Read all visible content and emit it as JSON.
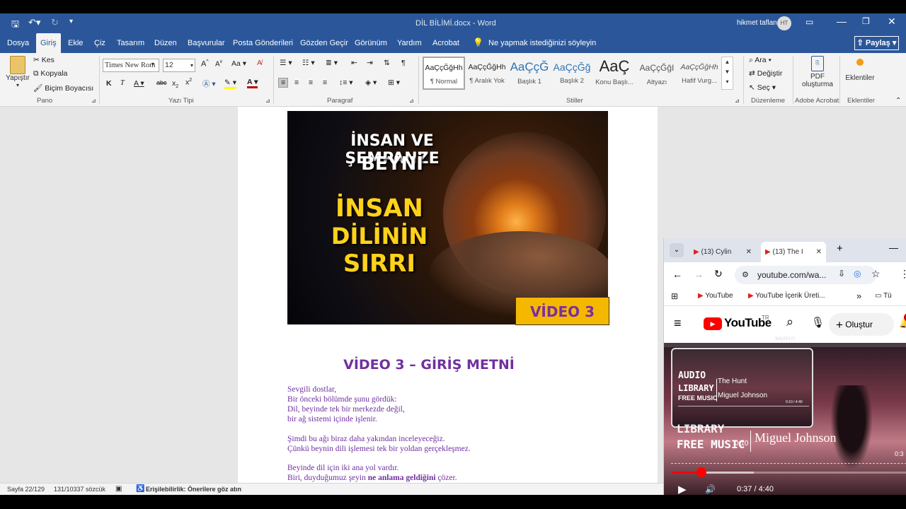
{
  "titlebar": {
    "doc_title": "DİL BİLİMİ.docx",
    "sep": "-",
    "app": "Word",
    "user": "hikmet taflan",
    "user_initials": "HT"
  },
  "ribbon_tabs": [
    "Dosya",
    "Giriş",
    "Ekle",
    "Çiz",
    "Tasarım",
    "Düzen",
    "Başvurular",
    "Posta Gönderileri",
    "Gözden Geçir",
    "Görünüm",
    "Yardım",
    "Acrobat"
  ],
  "tell_me": "Ne yapmak istediğinizi söyleyin",
  "share_label": "Paylaş",
  "clipboard": {
    "paste": "Yapıştır",
    "cut": "Kes",
    "copy": "Kopyala",
    "format_painter": "Biçim Boyacısı",
    "group": "Pano"
  },
  "font": {
    "name": "Times New Rom",
    "size": "12",
    "group": "Yazı Tipi",
    "case": "Aa"
  },
  "paragraph": {
    "group": "Paragraf"
  },
  "styles": {
    "group": "Stiller",
    "items": [
      {
        "sample": "AaÇçĞğHh",
        "name": "¶ Normal"
      },
      {
        "sample": "AaÇçĞğHh",
        "name": "¶ Aralık Yok"
      },
      {
        "sample": "AaÇçĞ",
        "name": "Başlık 1"
      },
      {
        "sample": "AaÇçĞğ",
        "name": "Başlık 2"
      },
      {
        "sample": "AaÇ",
        "name": "Konu Başlı..."
      },
      {
        "sample": "AaÇçĞğI",
        "name": "Altyazı"
      },
      {
        "sample": "AaÇçĞğHh",
        "name": "Hafif Vurg..."
      }
    ]
  },
  "editing": {
    "find": "Ara",
    "replace": "Değiştir",
    "select": "Seç",
    "group": "Düzenleme"
  },
  "acrobat": {
    "pdf": "PDF",
    "create": "oluşturma",
    "group": "Adobe Acrobat"
  },
  "addins": {
    "label": "Eklentiler",
    "group": "Eklentiler"
  },
  "thumbnail": {
    "line1": "İNSAN VE ŞEMPANZE",
    "line2": "BEYNİ",
    "line3": "İNSAN",
    "line4": "DİLİNİN",
    "line5": "SIRRI",
    "badge": "VİDEO 3"
  },
  "document": {
    "heading": "VİDEO 3 – GİRİŞ METNİ",
    "lines": [
      "Sevgili dostlar,",
      "Bir önceki bölümde şunu gördük:",
      "Dil, beyinde tek bir merkezde değil,",
      "bir ağ sistemi içinde işlenir.",
      "",
      "Şimdi bu ağı biraz daha yakından inceleyeceğiz.",
      "Çünkü beynin dili işlemesi tek bir yoldan gerçekleşmez.",
      "",
      "Beyinde dil için iki ana yol vardır."
    ],
    "last_line_pre": "Biri, duyduğumuz şeyin ",
    "last_line_bold": "ne anlama geldiğini",
    "last_line_post": " çözer."
  },
  "status": {
    "page": "Sayfa 22/129",
    "words": "131/10337 sözcük",
    "accessibility": "Erişilebilirlik: Önerilere göz atın"
  },
  "browser": {
    "tab1": "(13) Cylin",
    "tab2": "(13) The I",
    "url": "youtube.com/wa...",
    "bookmarks": [
      "YouTube",
      "YouTube İçerik Üreti...",
      "Tü"
    ],
    "yt_logo": "YouTube",
    "yt_region": "TR",
    "create": "Oluştur",
    "notif_count": "9",
    "player": {
      "mini_audio": "AUDIO",
      "mini_library": "LIBRARY",
      "mini_free": "FREE MUSIC",
      "mini_title": "The Hunt",
      "mini_artist": "Miguel Johnson",
      "mini_time": "0:10 / 4:40",
      "big_library": "LIBRARY",
      "big_free": "FREE MUSIC",
      "big_artist": "Miguel Johnson",
      "hover_time": "0:10",
      "side_time": "0:3",
      "time": "0:37 / 4:40",
      "top_text": "kaydırın",
      "progress": 0.13
    }
  }
}
